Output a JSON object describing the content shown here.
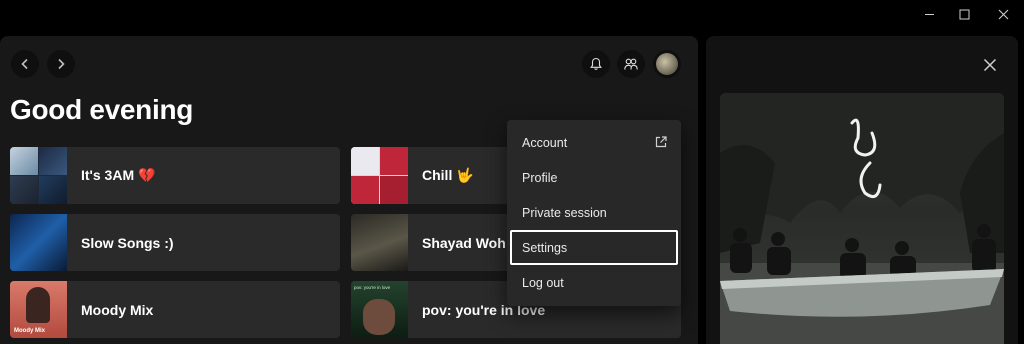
{
  "window": {
    "minimize_icon": "minimize-icon",
    "maximize_icon": "maximize-icon",
    "close_icon": "close-icon"
  },
  "topbar": {
    "back_icon": "chevron-left-icon",
    "forward_icon": "chevron-right-icon",
    "notifications_icon": "bell-icon",
    "friends_icon": "friends-icon"
  },
  "main": {
    "greeting": "Good evening",
    "cards": [
      {
        "label": "It's 3AM 💔"
      },
      {
        "label": "Chill 🤟"
      },
      {
        "label": "Slow Songs :)"
      },
      {
        "label": "Shayad Woh"
      },
      {
        "label": "Moody Mix",
        "thumb_text": "Moody Mix"
      },
      {
        "label": "pov: you're in love",
        "thumb_text": "pov: you're in love"
      }
    ]
  },
  "menu": {
    "items": [
      {
        "label": "Account",
        "icon": "external-link-icon"
      },
      {
        "label": "Profile"
      },
      {
        "label": "Private session"
      },
      {
        "label": "Settings",
        "selected": true
      },
      {
        "label": "Log out"
      }
    ]
  },
  "panel": {
    "close_icon": "close-icon"
  },
  "colors": {
    "background": "#000000",
    "surface": "#181818",
    "card": "#2a2a2a",
    "menu": "#282828",
    "text": "#ffffff"
  }
}
